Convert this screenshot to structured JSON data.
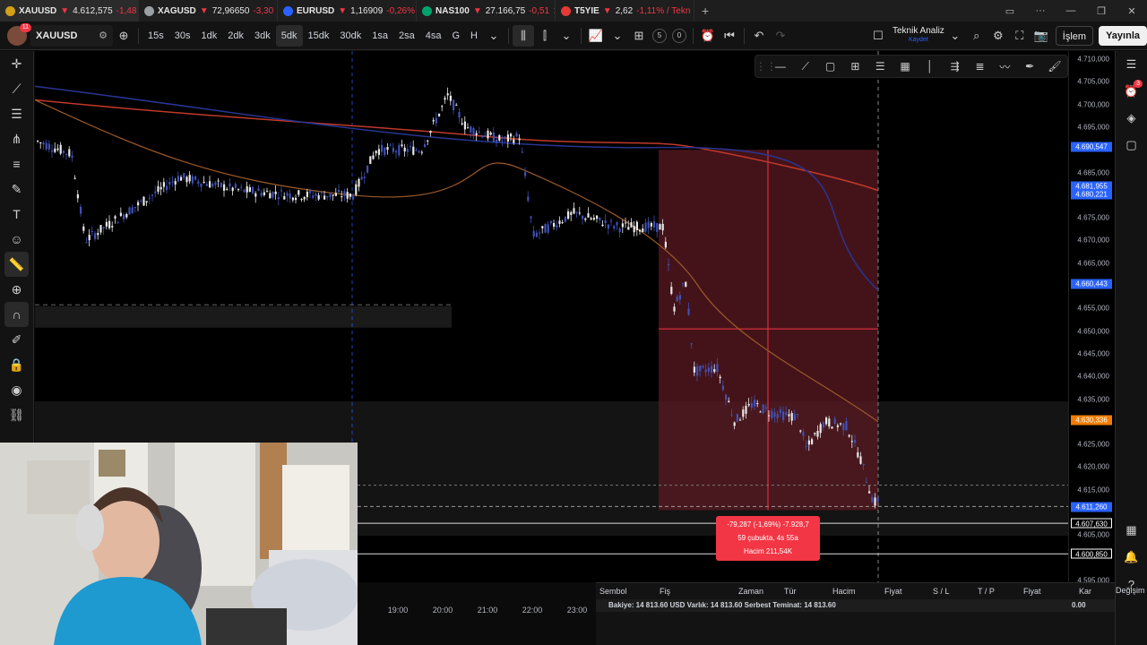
{
  "tabs": [
    {
      "symbol": "XAUUSD",
      "price": "4.612,575",
      "change": "-1,48",
      "icon_color": "#d4a017",
      "active": true
    },
    {
      "symbol": "XAGUSD",
      "price": "72,96650",
      "change": "-3,30",
      "icon_color": "#9aa0a6"
    },
    {
      "symbol": "EURUSD",
      "price": "1,16909",
      "change": "-0,26%",
      "icon_color": "#2962ff"
    },
    {
      "symbol": "NAS100",
      "price": "27.166,75",
      "change": "-0,51",
      "icon_color": "#00a36c"
    },
    {
      "symbol": "T5YIE",
      "price": "2,62",
      "change": "-1,11% / Tekn",
      "icon_color": "#e53935"
    }
  ],
  "toolbar": {
    "avatar_badge": "11",
    "symbol": "XAUUSD",
    "intervals": [
      "15s",
      "30s",
      "1dk",
      "2dk",
      "3dk",
      "5dk",
      "15dk",
      "30dk",
      "1sa",
      "2sa",
      "4sa",
      "G",
      "H"
    ],
    "selected_interval": "5dk",
    "replay_a": "5",
    "replay_b": "0",
    "analysis_title": "Teknik Analiz",
    "analysis_sub": "Kaydet",
    "trade_label": "İşlem",
    "publish_label": "Yayınla"
  },
  "price_axis": {
    "labels": [
      "4.710,000",
      "4.705,000",
      "4.700,000",
      "4.695,000",
      "4.685,000",
      "4.675,000",
      "4.670,000",
      "4.665,000",
      "4.655,000",
      "4.650,000",
      "4.645,000",
      "4.640,000",
      "4.635,000",
      "4.625,000",
      "4.620,000",
      "4.615,000",
      "4.605,000",
      "4.595,000"
    ],
    "badges": [
      {
        "value": "4.690,547",
        "color": "#2962ff"
      },
      {
        "value": "4.681,955",
        "color": "#2962ff"
      },
      {
        "value": "4.680,221",
        "color": "#2962ff"
      },
      {
        "value": "4.660,443",
        "color": "#2962ff"
      },
      {
        "value": "4.630,336",
        "color": "#f57c00"
      },
      {
        "value": "4.611,260",
        "color": "#2962ff"
      },
      {
        "value": "4.607,630",
        "color": "#ffffff"
      },
      {
        "value": "4.600,850",
        "color": "#ffffff"
      }
    ]
  },
  "time_axis": [
    "19:00",
    "20:00",
    "21:00",
    "22:00",
    "23:00"
  ],
  "measure_tooltip": {
    "line1": "-79,287 (-1,69%) -7.928,7",
    "line2": "59 çubukta, 4s 55a",
    "line3": "Hacim 211,54K"
  },
  "trade_panel": {
    "headers": [
      "Sembol",
      "Fiş",
      "Zaman",
      "Tür",
      "Hacim",
      "Fiyat",
      "S / L",
      "T / P",
      "Fiyat",
      "Kar",
      "Değişim"
    ],
    "balance_line": "Bakiye: 14 813.60 USD  Varlık: 14 813.60  Serbest Teminat: 14 813.60",
    "pnl": "0.00"
  },
  "right_tools_badge": "3"
}
